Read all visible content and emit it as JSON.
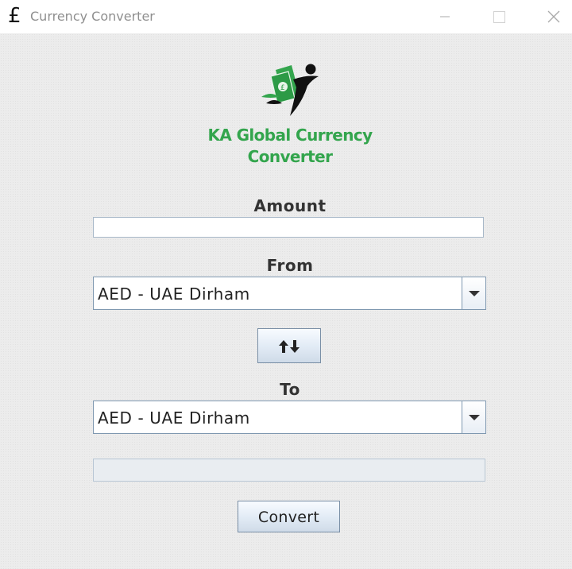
{
  "window": {
    "title": "Currency Converter",
    "app_icon": "£"
  },
  "brand": {
    "line1": "KA Global Currency",
    "line2": "Converter"
  },
  "labels": {
    "amount": "Amount",
    "from": "From",
    "to": "To"
  },
  "amount_input": {
    "value": ""
  },
  "from_select": {
    "selected": "AED - UAE Dirham"
  },
  "to_select": {
    "selected": "AED - UAE Dirham"
  },
  "result_field": {
    "value": ""
  },
  "buttons": {
    "convert": "Convert",
    "swap_icon": "swap-vertical-arrows-icon"
  },
  "colors": {
    "brand_green": "#33a54d",
    "logo_dark": "#111111"
  }
}
